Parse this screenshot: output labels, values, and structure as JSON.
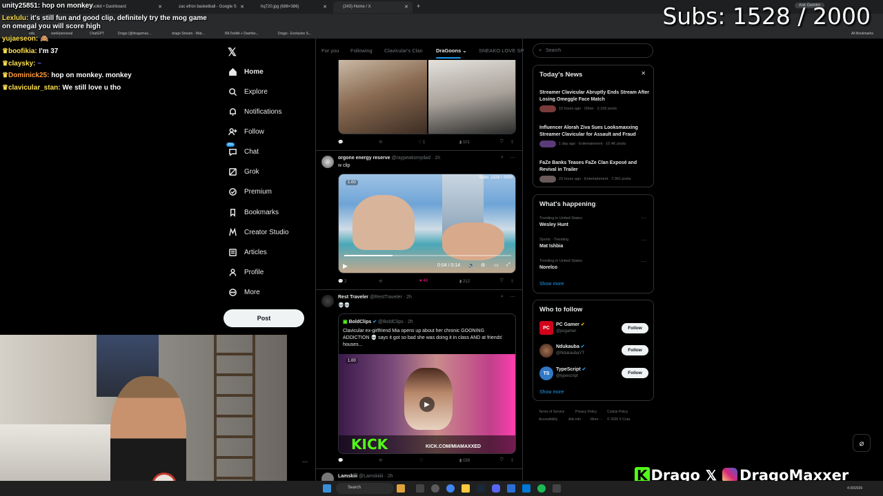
{
  "browser": {
    "tabs": [
      {
        "label": "Google Toolkit • Dashboard",
        "active": false
      },
      {
        "label": "zac efron basketball - Google S",
        "active": false
      },
      {
        "label": "hq720.jpg (686×386)",
        "active": false
      },
      {
        "label": "(243) Home / X",
        "active": true
      }
    ],
    "ask_gemini": "Ask Gemini",
    "bookmarks": [
      "edu",
      "work/personal",
      "ChatGPT",
      "Drago (@dragomax...",
      "drago Stream - Wat...",
      "IRLToolkit + Dashbo...",
      "Drago - Exclusive S..."
    ],
    "all_bookmarks": "All Bookmarks"
  },
  "stream": {
    "subs": "Subs: 1528 / 2000",
    "chat": [
      {
        "user": "unity25851:",
        "message": "hop on monkey",
        "color": "#ffffff"
      },
      {
        "user": "Lexlulu:",
        "message": "it's still fun and good clip, definitely try the mog game on omegal you will score high",
        "color": "#ffe14d"
      },
      {
        "user": "yujaeseon:",
        "message": "",
        "color": "#ffe14d"
      },
      {
        "user": "boofikia:",
        "message": "I'm 37",
        "color": "#ffe14d"
      },
      {
        "user": "claysky:",
        "message": "",
        "color": "#ffe14d"
      },
      {
        "user": "Dominick25:",
        "message": "hop on monkey. monkey",
        "color": "#ff9b3d"
      },
      {
        "user": "clavicular_stan:",
        "message": "We still love u tho",
        "color": "#ffe14d"
      }
    ],
    "brand_text": "Drago",
    "brand_handle": "DragoMaxxer"
  },
  "nav": {
    "items": [
      {
        "label": "Home",
        "icon": "home-icon"
      },
      {
        "label": "Explore",
        "icon": "search-icon"
      },
      {
        "label": "Notifications",
        "icon": "bell-icon"
      },
      {
        "label": "Follow",
        "icon": "person-add-icon"
      },
      {
        "label": "Chat",
        "icon": "chat-icon",
        "badge": "20+"
      },
      {
        "label": "Grok",
        "icon": "grok-icon"
      },
      {
        "label": "Premium",
        "icon": "premium-icon"
      },
      {
        "label": "Bookmarks",
        "icon": "bookmark-icon"
      },
      {
        "label": "Creator Studio",
        "icon": "creator-icon"
      },
      {
        "label": "Articles",
        "icon": "article-icon"
      },
      {
        "label": "Profile",
        "icon": "profile-icon"
      },
      {
        "label": "More",
        "icon": "more-icon"
      }
    ],
    "post": "Post"
  },
  "feed": {
    "tabs": [
      "For you",
      "Following",
      "Clavicular's Clan",
      "DraGoons",
      "SNEAKO LOVE SP"
    ],
    "tweet1": {
      "replies": "",
      "retweets": "",
      "likes": "1",
      "views": "101"
    },
    "tweet2": {
      "name": "orgone energy reserve",
      "handle": "@raypeatismydad · 1h",
      "text": "w clip",
      "video_speed": "1.00",
      "video_subs": "Subs: 1528 / 2000",
      "video_time": "0:04 / 0:14",
      "video_progress": 0.29,
      "replies": "2",
      "retweets": "",
      "likes": "48",
      "views": "212"
    },
    "tweet3": {
      "name": "Rest Traveler",
      "handle": "@RestTraveler · 2h",
      "text": "💀💀",
      "quote_name": "BoldClips",
      "quote_handle": "@BoldClips · 2h",
      "quote_text": "Clavicular ex-girlfriend Mia opens up about her chronic GOONING ADDICTION 💀 says it got so bad she was doing it in class AND at friends' houses...",
      "video_speed": "1.00",
      "kick_logo": "KICK",
      "kick_url": "KICK.COM/MIAMAXXED",
      "replies": "",
      "retweets": "",
      "likes": "",
      "views": "158"
    },
    "tweet4": {
      "name": "Lamskiii",
      "handle": "@Lamskiiiii · 2h"
    }
  },
  "sidebar": {
    "search_placeholder": "Search",
    "news_title": "Today's News",
    "news": [
      {
        "headline": "Streamer Clavicular Abruptly Ends Stream After Losing Omeggle Face Match",
        "meta": "15 hours ago · Other · 2,156 posts"
      },
      {
        "headline": "Influencer Alorah Ziva Sues Looksmaxxing Streamer Clavicular for Assault and Fraud",
        "meta": "1 day ago · Entertainment · 10.4K posts"
      },
      {
        "headline": "FaZe Banks Teases FaZe Clan Exposé and Revival in Trailer",
        "meta": "23 hours ago · Entertainment · 7,001 posts"
      }
    ],
    "happening_title": "What's happening",
    "trends": [
      {
        "context": "Trending in United States",
        "name": "Wesley Hunt"
      },
      {
        "context": "Sports · Trending",
        "name": "Mat Ishbia"
      },
      {
        "context": "Trending in United States",
        "name": "Norelco"
      }
    ],
    "show_more": "Show more",
    "wtf_title": "Who to follow",
    "wtf": [
      {
        "name": "PC Gamer",
        "handle": "@pcgamer",
        "avatar_color": "#d0021b",
        "avatar_text": "PC"
      },
      {
        "name": "Ndukauba",
        "handle": "@NdukaubaYT",
        "avatar_color": "#6b4a3a",
        "avatar_text": ""
      },
      {
        "name": "TypeScript",
        "handle": "@typescript",
        "avatar_color": "#3178c6",
        "avatar_text": "TS"
      }
    ],
    "follow_label": "Follow",
    "footer": [
      "Terms of Service",
      "Privacy Policy",
      "Cookie Policy",
      "Accessibility",
      "Ads info",
      "More ···",
      "© 2026 X Corp."
    ]
  },
  "taskbar": {
    "search": "Search",
    "clock_time": "4:30/2026"
  },
  "colors": {
    "accent": "#1d9bf0",
    "like": "#f91880",
    "kick": "#53fc18"
  }
}
